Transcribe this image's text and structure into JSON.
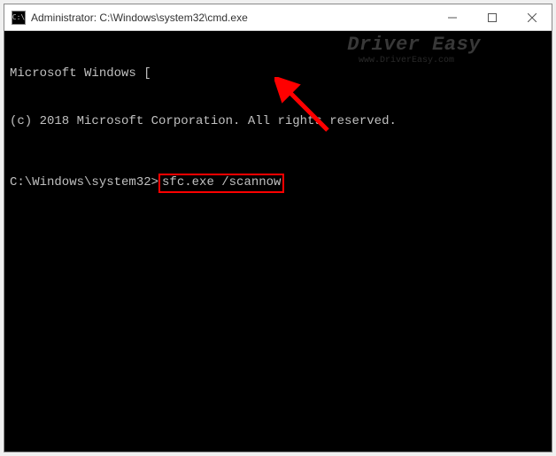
{
  "titlebar": {
    "icon_glyph": "C:\\",
    "title": "Administrator: C:\\Windows\\system32\\cmd.exe"
  },
  "console": {
    "line1": "Microsoft Windows [",
    "copyright": "(c) 2018 Microsoft Corporation. All rights reserved.",
    "prompt": "C:\\Windows\\system32>",
    "command": "sfc.exe /scannow"
  },
  "watermark": {
    "brand": "Driver Easy",
    "url": "www.DriverEasy.com"
  },
  "colors": {
    "highlight_box": "#ff0000",
    "arrow": "#ff0000",
    "console_bg": "#000000",
    "console_fg": "#c0c0c0"
  }
}
